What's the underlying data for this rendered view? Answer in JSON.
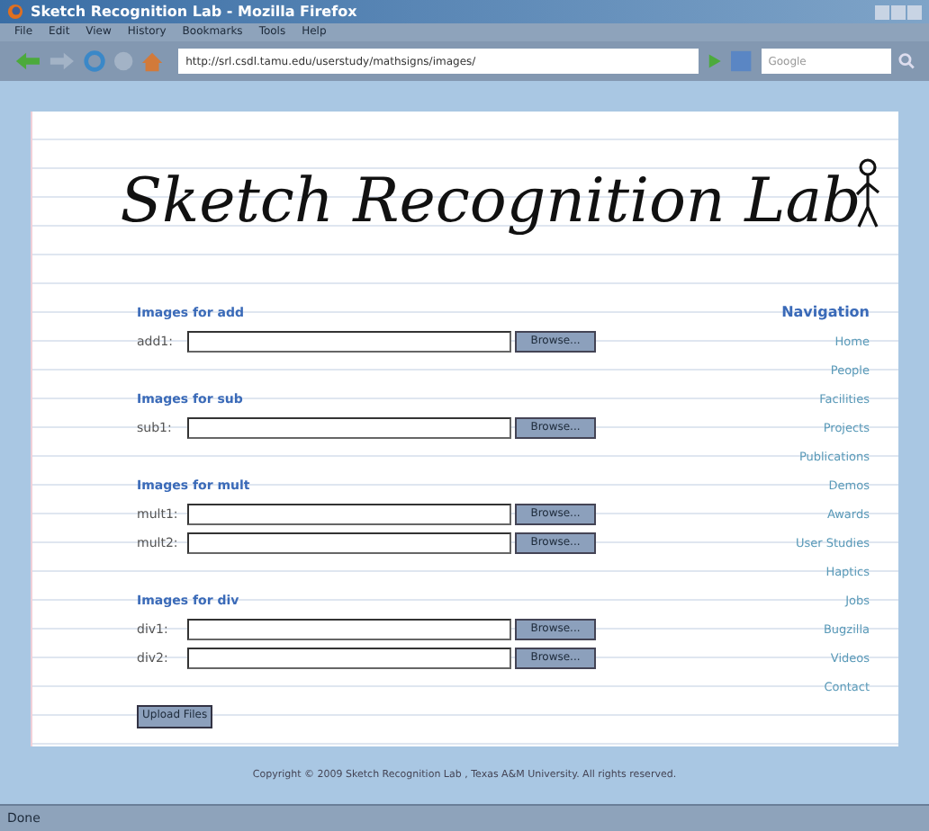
{
  "window": {
    "title": "Sketch Recognition Lab - Mozilla Firefox"
  },
  "menu": [
    "File",
    "Edit",
    "View",
    "History",
    "Bookmarks",
    "Tools",
    "Help"
  ],
  "toolbar": {
    "url": "http://srl.csdl.tamu.edu/userstudy/mathsigns/images/",
    "search_placeholder": "Google"
  },
  "logo": {
    "text": "Sketch Recognition Lab"
  },
  "sections": [
    {
      "heading": "Images for add",
      "fields": [
        {
          "label": "add1:",
          "button": "Browse..."
        }
      ]
    },
    {
      "heading": "Images for sub",
      "fields": [
        {
          "label": "sub1:",
          "button": "Browse..."
        }
      ]
    },
    {
      "heading": "Images for mult",
      "fields": [
        {
          "label": "mult1:",
          "button": "Browse..."
        },
        {
          "label": "mult2:",
          "button": "Browse..."
        }
      ]
    },
    {
      "heading": "Images for div",
      "fields": [
        {
          "label": "div1:",
          "button": "Browse..."
        },
        {
          "label": "div2:",
          "button": "Browse..."
        }
      ]
    }
  ],
  "upload_button": "Upload Files",
  "navigation": {
    "heading": "Navigation",
    "items": [
      "Home",
      "People",
      "Facilities",
      "Projects",
      "Publications",
      "Demos",
      "Awards",
      "User Studies",
      "Haptics",
      "Jobs",
      "Bugzilla",
      "Videos",
      "Contact"
    ]
  },
  "copyright": "Copyright © 2009 Sketch Recognition Lab , Texas A&M University. All rights reserved.",
  "status": "Done"
}
